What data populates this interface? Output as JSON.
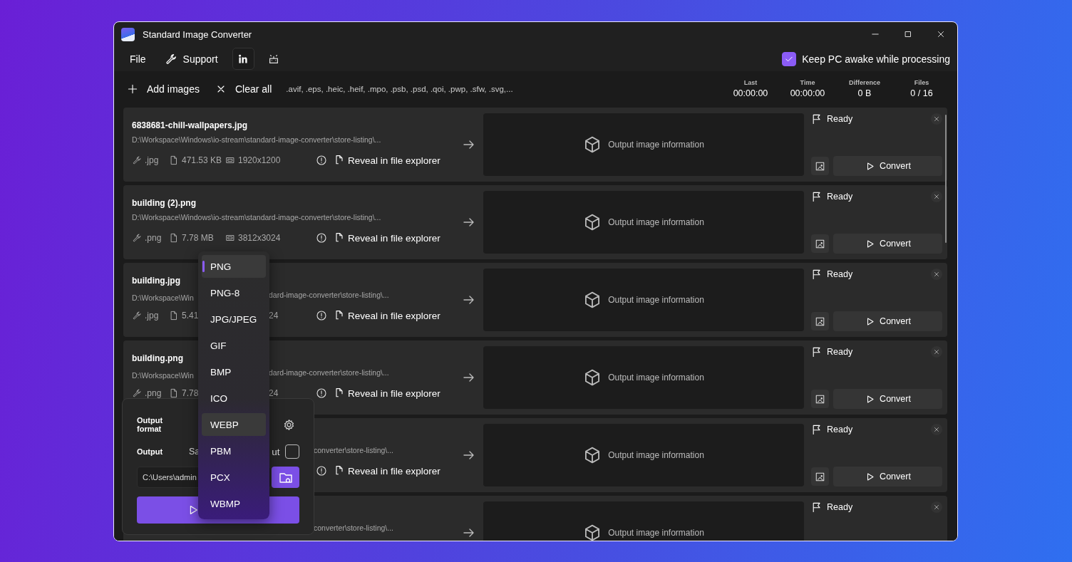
{
  "window": {
    "title": "Standard Image Converter"
  },
  "menu": {
    "file": "File",
    "support": "Support"
  },
  "keep_awake": {
    "label": "Keep PC awake while processing",
    "checked": true
  },
  "toolbar": {
    "add": "Add images",
    "clear": "Clear all",
    "formats": ".avif, .eps, .heic, .heif, .mpo, .psb, .psd, .qoi, .pwp, .sfw, .svg,..."
  },
  "stats": [
    {
      "label": "Last",
      "value": "00:00:00"
    },
    {
      "label": "Time",
      "value": "00:00:00"
    },
    {
      "label": "Difference",
      "value": "0 B"
    },
    {
      "label": "Files",
      "value": "0 / 16"
    }
  ],
  "rows": [
    {
      "name": "6838681-chill-wallpapers.jpg",
      "path": "D:\\Workspace\\Windows\\io-stream\\standard-image-converter\\store-listing\\...",
      "ext": ".jpg",
      "size": "471.53 KB",
      "dims": "1920x1200",
      "reveal": "Reveal in file explorer",
      "output": "Output image information",
      "status": "Ready",
      "convert": "Convert"
    },
    {
      "name": "building (2).png",
      "path": "D:\\Workspace\\Windows\\io-stream\\standard-image-converter\\store-listing\\...",
      "ext": ".png",
      "size": "7.78 MB",
      "dims": "3812x3024",
      "reveal": "Reveal in file explorer",
      "output": "Output image information",
      "status": "Ready",
      "convert": "Convert"
    },
    {
      "name": "building.jpg",
      "path_head": "D:\\Workspace\\Win",
      "path_tail": "dard-image-converter\\store-listing\\...",
      "ext": ".jpg",
      "size": "5.41",
      "dims": "24",
      "reveal": "Reveal in file explorer",
      "output": "Output image information",
      "status": "Ready",
      "convert": "Convert"
    },
    {
      "name": "building.png",
      "path_head": "D:\\Workspace\\Win",
      "path_tail": "dard-image-converter\\store-listing\\...",
      "ext": ".png",
      "size": "7.78",
      "dims": "24",
      "reveal": "Reveal in file explorer",
      "output": "Output image information",
      "status": "Ready",
      "convert": "Convert"
    },
    {
      "path_tail": "converter\\store-listing\\...",
      "reveal": "Reveal in file explorer",
      "output": "Output image information",
      "status": "Ready",
      "convert": "Convert"
    },
    {
      "path_tail": "converter\\store-listing\\...",
      "output": "Output image information",
      "status": "Ready"
    }
  ],
  "output_panel": {
    "format_label": "Output format",
    "output_label": "Output",
    "save_head": "Sa",
    "save_tail": "ut",
    "save_checked": false,
    "path_value": "C:\\Users\\admin"
  },
  "format_menu": [
    {
      "label": "PNG",
      "selected": true,
      "highlighted": false
    },
    {
      "label": "PNG-8",
      "selected": false,
      "highlighted": false
    },
    {
      "label": "JPG/JPEG",
      "selected": false,
      "highlighted": false
    },
    {
      "label": "GIF",
      "selected": false,
      "highlighted": false
    },
    {
      "label": "BMP",
      "selected": false,
      "highlighted": false
    },
    {
      "label": "ICO",
      "selected": false,
      "highlighted": false
    },
    {
      "label": "WEBP",
      "selected": false,
      "highlighted": true
    },
    {
      "label": "PBM",
      "selected": false,
      "highlighted": false
    },
    {
      "label": "PCX",
      "selected": false,
      "highlighted": false
    },
    {
      "label": "WBMP",
      "selected": false,
      "highlighted": false
    }
  ]
}
